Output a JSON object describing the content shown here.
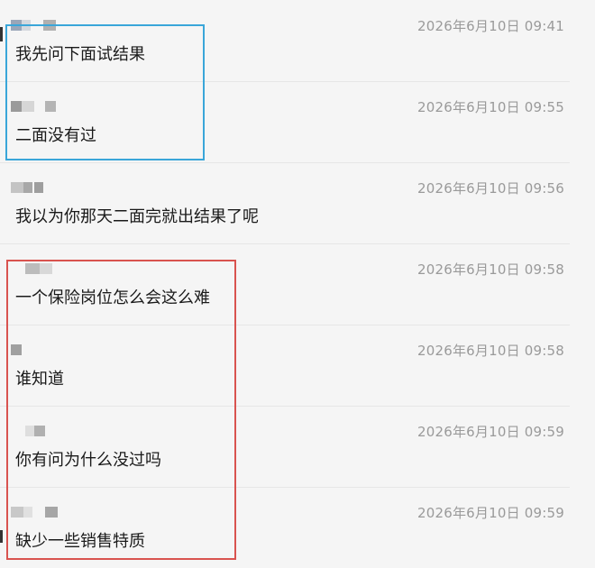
{
  "messages": [
    {
      "time": "2026年6月10日 09:41",
      "text": "我先问下面试结果"
    },
    {
      "time": "2026年6月10日 09:55",
      "text": "二面没有过"
    },
    {
      "time": "2026年6月10日 09:56",
      "text": "我以为你那天二面完就出结果了呢"
    },
    {
      "time": "2026年6月10日 09:58",
      "text": "一个保险岗位怎么会这么难"
    },
    {
      "time": "2026年6月10日 09:58",
      "text": "谁知道"
    },
    {
      "time": "2026年6月10日 09:59",
      "text": "你有问为什么没过吗"
    },
    {
      "time": "2026年6月10日 09:59",
      "text": "缺少一些销售特质"
    }
  ],
  "colors": {
    "highlight_blue": "#3aa6d9",
    "highlight_red": "#d9534f",
    "timestamp": "#9a9a9a",
    "text": "#1a1a1a",
    "background": "#f5f5f5"
  }
}
